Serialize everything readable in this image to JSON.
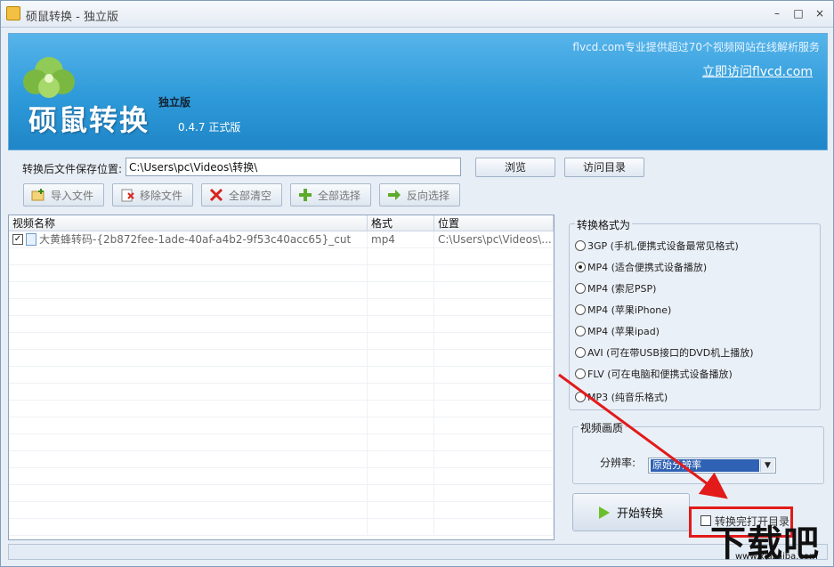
{
  "window": {
    "title": "硕鼠转换 - 独立版",
    "controls": [
      "–",
      "□",
      "×"
    ]
  },
  "banner": {
    "brand": "硕鼠转换",
    "edition": "独立版",
    "version": "0.4.7  正式版",
    "slogan": "flvcd.com专业提供超过70个视频网站在线解析服务",
    "visit_link": "立即访问flvcd.com"
  },
  "output": {
    "label": "转换后文件保存位置:",
    "path": "C:\\Users\\pc\\Videos\\转换\\",
    "browse_label": "浏览",
    "open_dir_label": "访问目录"
  },
  "toolbar": {
    "import": "导入文件",
    "remove": "移除文件",
    "clear_all": "全部清空",
    "select_all": "全部选择",
    "invert": "反向选择"
  },
  "file_list": {
    "columns": [
      "视频名称",
      "格式",
      "位置"
    ],
    "rows": [
      {
        "checked": true,
        "name": "大黄蜂转码-{2b872fee-1ade-40af-a4b2-9f53c40acc65}_cut",
        "format": "mp4",
        "location": "C:\\Users\\pc\\Videos\\..."
      }
    ]
  },
  "formats": {
    "legend": "转换格式为",
    "options": [
      {
        "label": "3GP (手机,便携式设备最常见格式)",
        "selected": false
      },
      {
        "label": "MP4 (适合便携式设备播放)",
        "selected": true
      },
      {
        "label": "MP4 (索尼PSP)",
        "selected": false
      },
      {
        "label": "MP4 (苹果iPhone)",
        "selected": false
      },
      {
        "label": "MP4 (苹果ipad)",
        "selected": false
      },
      {
        "label": "AVI  (可在带USB接口的DVD机上播放)",
        "selected": false
      },
      {
        "label": "FLV  (可在电脑和便携式设备播放)",
        "selected": false
      },
      {
        "label": "MP3 (纯音乐格式)",
        "selected": false
      }
    ]
  },
  "quality": {
    "legend": "视频画质",
    "resolution_label": "分辨率:",
    "resolution_value": "原始分辨率"
  },
  "actions": {
    "start_label": "开始转换",
    "open_after_label": "转换完打开目录"
  },
  "watermark": {
    "big": "下载吧",
    "small": "www.xiazaiba.com"
  },
  "colors": {
    "banner": "#2e9ad9",
    "highlight": "#e21a1a",
    "selection": "#2f61b4"
  }
}
